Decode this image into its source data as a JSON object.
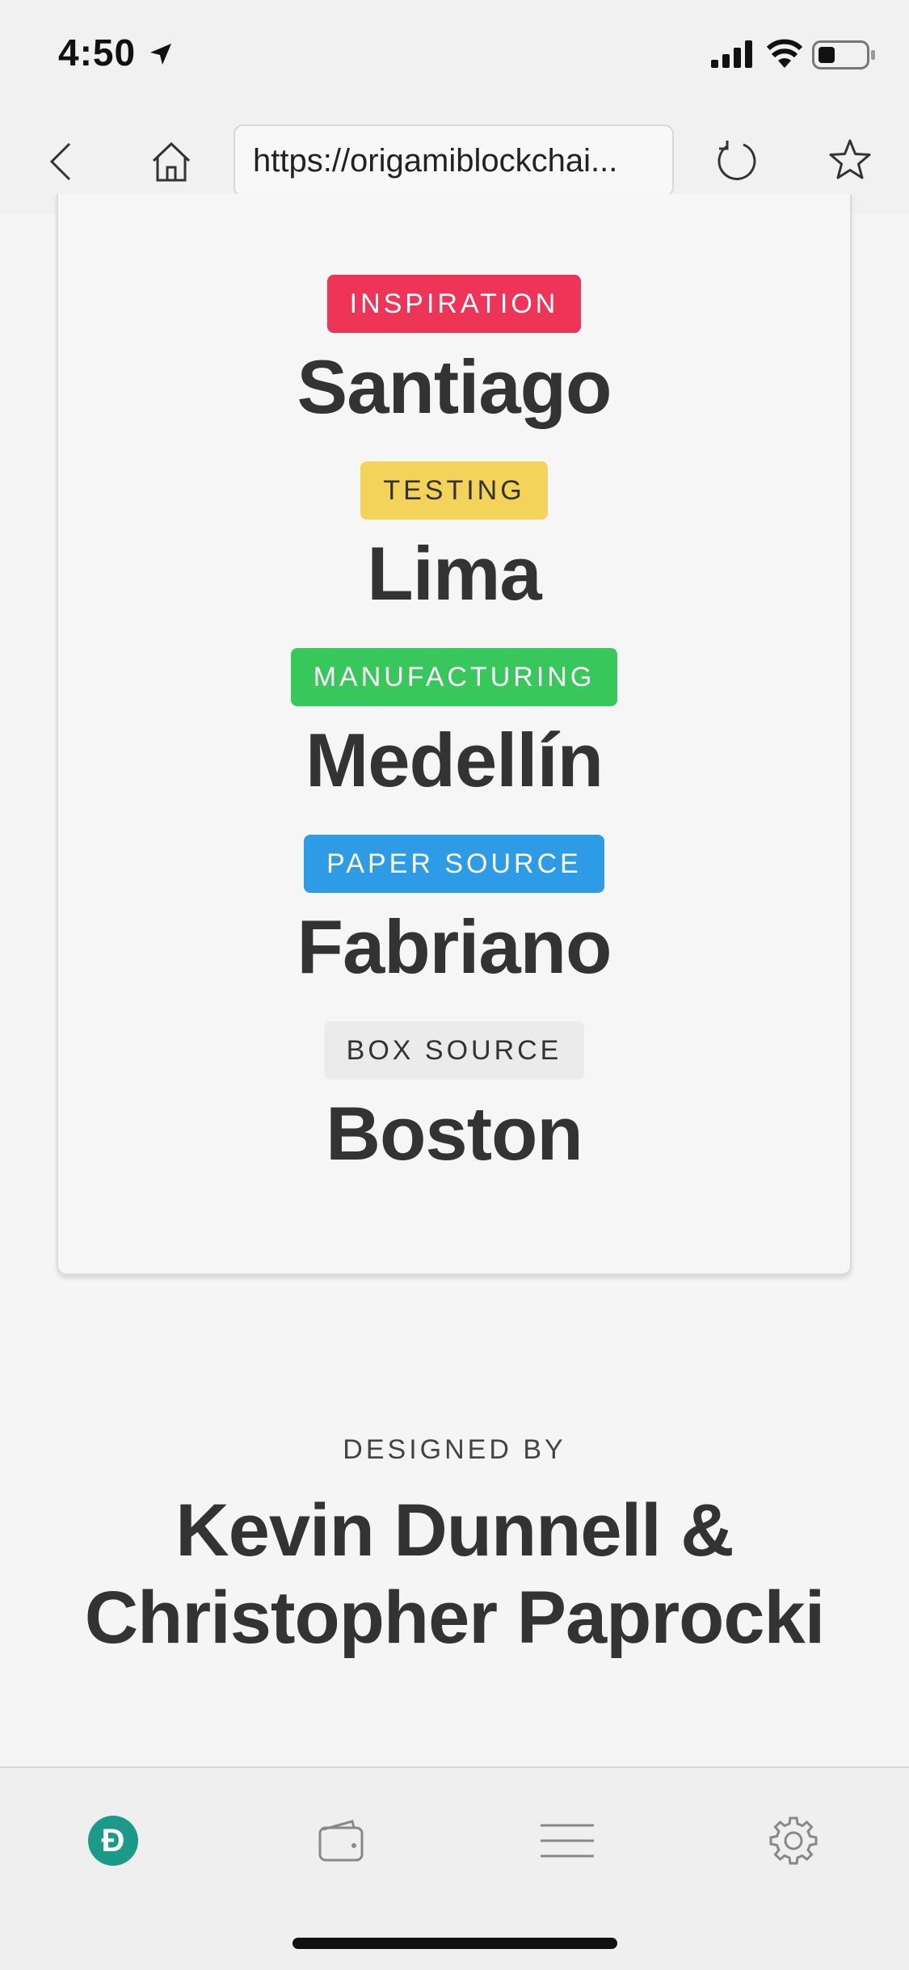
{
  "status_bar": {
    "time": "4:50"
  },
  "browser": {
    "url": "https://origamiblockchai..."
  },
  "locations": [
    {
      "tag": "INSPIRATION",
      "tag_color": "#ee3557",
      "tag_text_color": "#ffffff",
      "city": "Santiago"
    },
    {
      "tag": "TESTING",
      "tag_color": "#f4d35a",
      "tag_text_color": "#333333",
      "city": "Lima"
    },
    {
      "tag": "MANUFACTURING",
      "tag_color": "#37c75b",
      "tag_text_color": "#ffffff",
      "city": "Medellín"
    },
    {
      "tag": "PAPER SOURCE",
      "tag_color": "#2e9be6",
      "tag_text_color": "#ffffff",
      "city": "Fabriano"
    },
    {
      "tag": "BOX SOURCE",
      "tag_color": "#ebebeb",
      "tag_text_color": "#333333",
      "city": "Boston"
    }
  ],
  "footer": {
    "designed_by_label": "DESIGNED BY",
    "designer_line1": "Kevin Dunnell &",
    "designer_line2": "Christopher Paprocki"
  },
  "tabbar": {
    "home_logo_glyph": "Đ",
    "accent_color": "#1b9a8a",
    "icons": [
      "dash-logo-icon",
      "wallet-icon",
      "menu-icon",
      "gear-icon"
    ]
  }
}
